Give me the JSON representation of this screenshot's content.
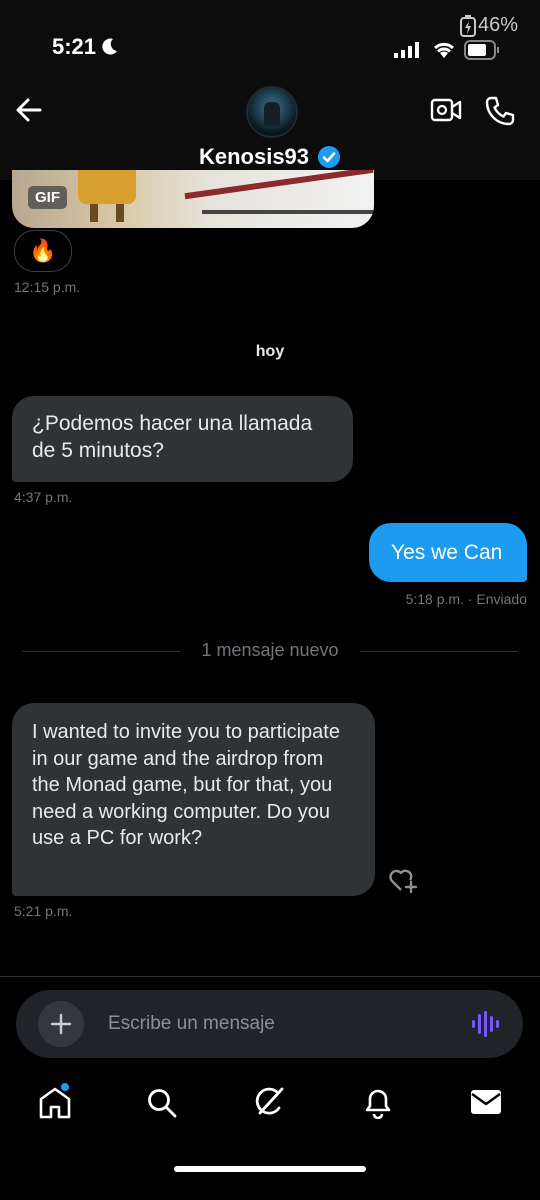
{
  "status_bar": {
    "time": "5:21",
    "battery_pct": "46%"
  },
  "header": {
    "username": "Kenosis93"
  },
  "messages": {
    "gif_label": "GIF",
    "reaction": "🔥",
    "gif_time": "12:15 p.m.",
    "day_separator": "hoy",
    "msg1_text": "¿Podemos hacer una llamada de 5 minutos?",
    "msg1_time": "4:37 p.m.",
    "msg2_text": "Yes we Can",
    "msg2_meta": "5:18 p.m. · Enviado",
    "new_divider": "1 mensaje nuevo",
    "msg3_text": "I wanted to invite you to participate in our game and the airdrop from the Monad game, but for that, you need a working computer. Do you use a PC for work?",
    "msg3_time": "5:21 p.m."
  },
  "composer": {
    "placeholder": "Escribe un mensaje"
  },
  "colors": {
    "accent": "#1d9bf0",
    "bubble_in": "#2f3336",
    "voice": "#7856ff"
  },
  "icons": [
    "back-arrow-icon",
    "video-call-icon",
    "phone-icon",
    "verified-badge-icon",
    "heart-add-icon",
    "plus-icon",
    "voice-icon",
    "home-icon",
    "search-icon",
    "grok-icon",
    "bell-icon",
    "mail-icon"
  ]
}
